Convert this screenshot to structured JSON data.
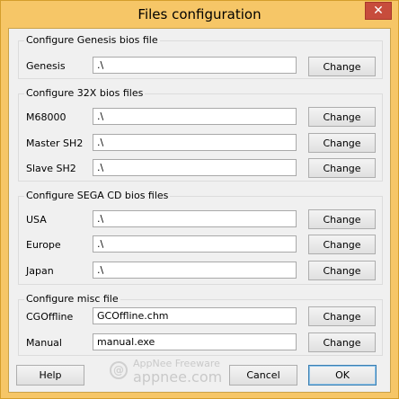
{
  "window": {
    "title": "Files configuration",
    "close_glyph": "✕"
  },
  "genesis": {
    "legend": "Configure Genesis bios file",
    "rows": [
      {
        "label": "Genesis",
        "value": ".\\",
        "button": "Change"
      }
    ]
  },
  "s32x": {
    "legend": "Configure 32X bios files",
    "rows": [
      {
        "label": "M68000",
        "value": ".\\",
        "button": "Change"
      },
      {
        "label": "Master SH2",
        "value": ".\\",
        "button": "Change"
      },
      {
        "label": "Slave SH2",
        "value": ".\\",
        "button": "Change"
      }
    ]
  },
  "segacd": {
    "legend": "Configure SEGA CD bios files",
    "rows": [
      {
        "label": "USA",
        "value": ".\\",
        "button": "Change"
      },
      {
        "label": "Europe",
        "value": ".\\",
        "button": "Change"
      },
      {
        "label": "Japan",
        "value": ".\\",
        "button": "Change"
      }
    ]
  },
  "misc": {
    "legend": "Configure misc file",
    "rows": [
      {
        "label": "CGOffline",
        "value": "GCOffline.chm",
        "button": "Change"
      },
      {
        "label": "Manual",
        "value": "manual.exe",
        "button": "Change"
      }
    ]
  },
  "footer": {
    "help": "Help",
    "cancel": "Cancel",
    "ok": "OK"
  },
  "watermark": {
    "line1": "AppNee Freeware",
    "line2": "appnee.com"
  }
}
